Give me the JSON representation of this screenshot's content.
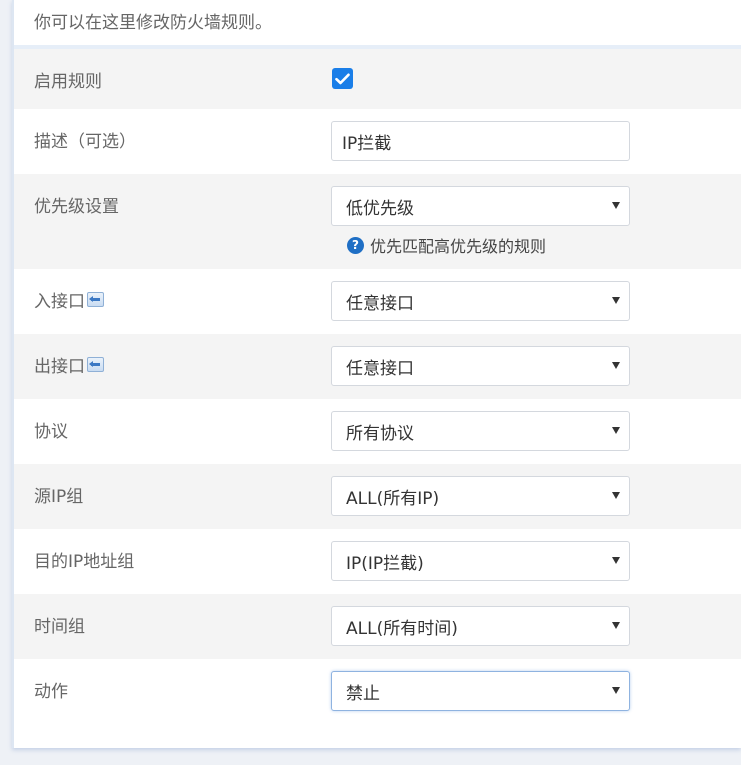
{
  "intro_text": "你可以在这里修改防火墙规则。",
  "rows": {
    "enable": {
      "label": "启用规则",
      "checked": true
    },
    "description": {
      "label": "描述（可选）",
      "value": "IP拦截"
    },
    "priority": {
      "label": "优先级设置",
      "value": "低优先级",
      "hint": "优先匹配高优先级的规则"
    },
    "in_iface": {
      "label": "入接口",
      "value": "任意接口"
    },
    "out_iface": {
      "label": "出接口",
      "value": "任意接口"
    },
    "protocol": {
      "label": "协议",
      "value": "所有协议"
    },
    "src_ip": {
      "label": "源IP组",
      "value": "ALL(所有IP)"
    },
    "dst_ip": {
      "label": "目的IP地址组",
      "value": "IP(IP拦截)"
    },
    "time": {
      "label": "时间组",
      "value": "ALL(所有时间)"
    },
    "action": {
      "label": "动作",
      "value": "禁止"
    }
  },
  "colors": {
    "accent": "#1a7ee8",
    "row_shade": "#f4f4f4",
    "help_icon": "#1f6fc5"
  }
}
